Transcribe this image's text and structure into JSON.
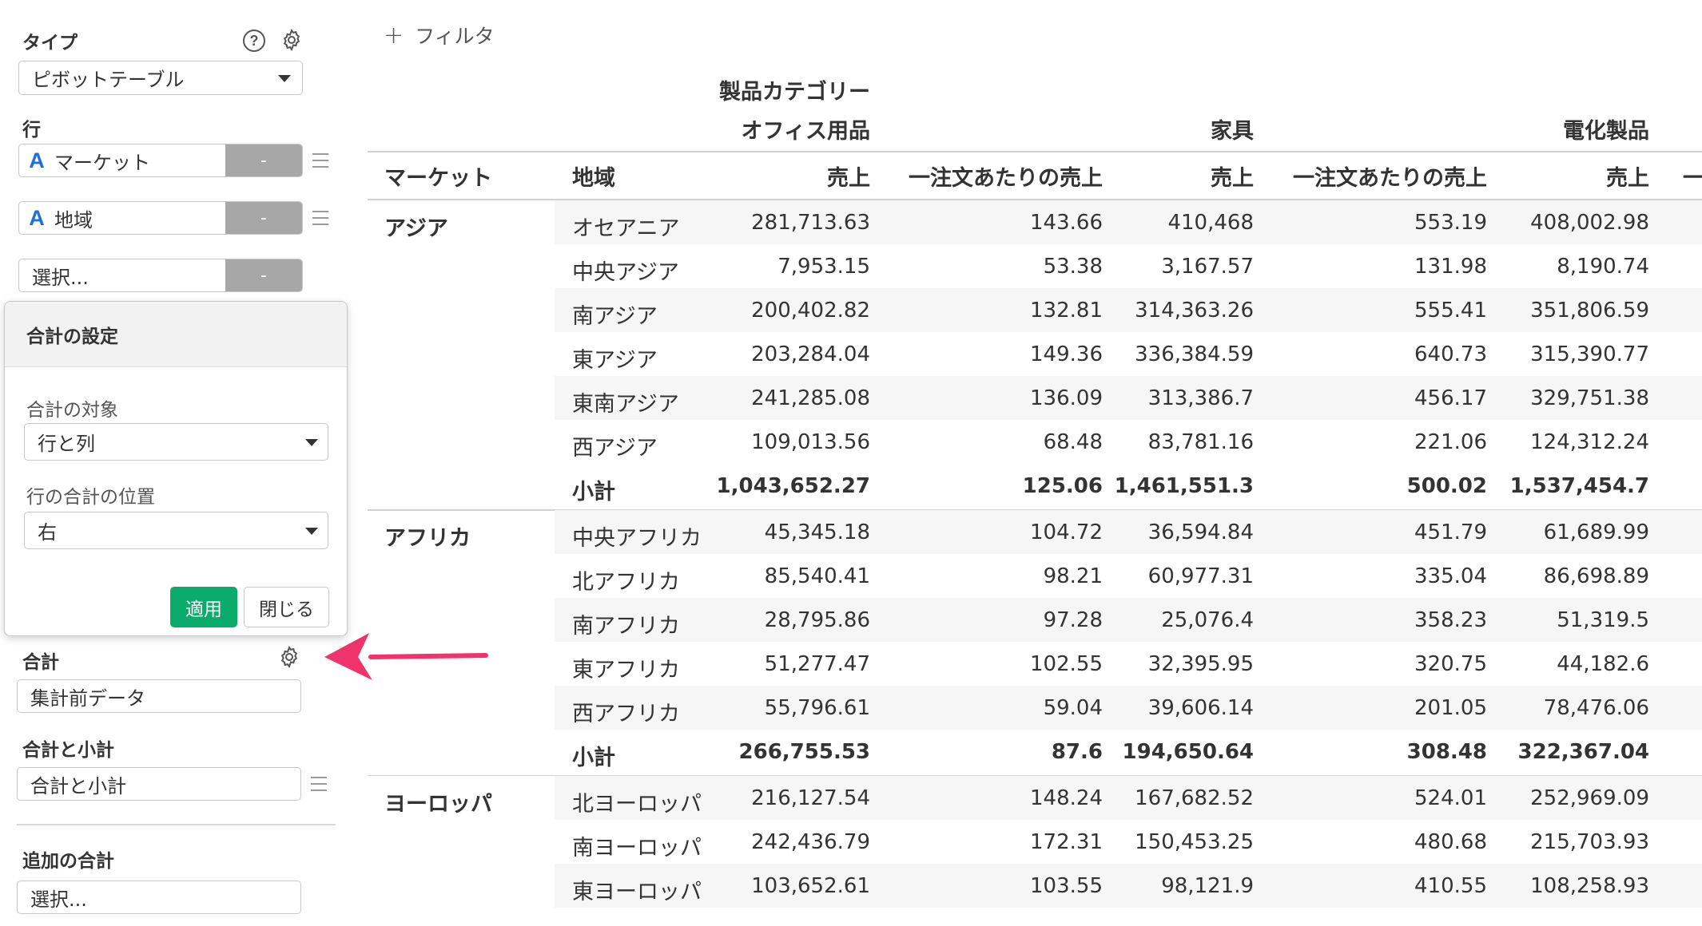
{
  "panel": {
    "type_label": "タイプ",
    "type_value": "ピボットテーブル",
    "row_label": "行",
    "row_fields": [
      "マーケット",
      "地域"
    ],
    "row_select_placeholder": "選択...",
    "minus_label": "-",
    "total_label": "合計",
    "total_value": "集計前データ",
    "total_subtotal_label": "合計と小計",
    "total_subtotal_value": "合計と小計",
    "additional_total_label": "追加の合計",
    "additional_total_placeholder": "選択..."
  },
  "popover": {
    "title": "合計の設定",
    "target_label": "合計の対象",
    "target_value": "行と列",
    "position_label": "行の合計の位置",
    "position_value": "右",
    "apply_label": "適用",
    "close_label": "閉じる"
  },
  "filter": {
    "label": "フィルタ"
  },
  "pivot": {
    "column_dimension": "製品カテゴリー",
    "categories": [
      "オフィス用品",
      "家具",
      "電化製品"
    ],
    "row_headers": {
      "market": "マーケット",
      "region": "地域"
    },
    "measures": [
      "売上",
      "一注文あたりの売上",
      "売上",
      "一注文あたりの売上",
      "売上"
    ],
    "trailing_header": "一",
    "groups": [
      {
        "market": "アジア",
        "rows": [
          {
            "region": "オセアニア",
            "values": [
              "281,713.63",
              "143.66",
              "410,468",
              "553.19",
              "408,002.98"
            ]
          },
          {
            "region": "中央アジア",
            "values": [
              "7,953.15",
              "53.38",
              "3,167.57",
              "131.98",
              "8,190.74"
            ]
          },
          {
            "region": "南アジア",
            "values": [
              "200,402.82",
              "132.81",
              "314,363.26",
              "555.41",
              "351,806.59"
            ]
          },
          {
            "region": "東アジア",
            "values": [
              "203,284.04",
              "149.36",
              "336,384.59",
              "640.73",
              "315,390.77"
            ]
          },
          {
            "region": "東南アジア",
            "values": [
              "241,285.08",
              "136.09",
              "313,386.7",
              "456.17",
              "329,751.38"
            ]
          },
          {
            "region": "西アジア",
            "values": [
              "109,013.56",
              "68.48",
              "83,781.16",
              "221.06",
              "124,312.24"
            ]
          }
        ],
        "subtotal": {
          "label": "小計",
          "values": [
            "1,043,652.27",
            "125.06",
            "1,461,551.3",
            "500.02",
            "1,537,454.7"
          ]
        }
      },
      {
        "market": "アフリカ",
        "rows": [
          {
            "region": "中央アフリカ",
            "values": [
              "45,345.18",
              "104.72",
              "36,594.84",
              "451.79",
              "61,689.99"
            ]
          },
          {
            "region": "北アフリカ",
            "values": [
              "85,540.41",
              "98.21",
              "60,977.31",
              "335.04",
              "86,698.89"
            ]
          },
          {
            "region": "南アフリカ",
            "values": [
              "28,795.86",
              "97.28",
              "25,076.4",
              "358.23",
              "51,319.5"
            ]
          },
          {
            "region": "東アフリカ",
            "values": [
              "51,277.47",
              "102.55",
              "32,395.95",
              "320.75",
              "44,182.6"
            ]
          },
          {
            "region": "西アフリカ",
            "values": [
              "55,796.61",
              "59.04",
              "39,606.14",
              "201.05",
              "78,476.06"
            ]
          }
        ],
        "subtotal": {
          "label": "小計",
          "values": [
            "266,755.53",
            "87.6",
            "194,650.64",
            "308.48",
            "322,367.04"
          ]
        }
      },
      {
        "market": "ヨーロッパ",
        "rows": [
          {
            "region": "北ヨーロッパ",
            "values": [
              "216,127.54",
              "148.24",
              "167,682.52",
              "524.01",
              "252,969.09"
            ]
          },
          {
            "region": "南ヨーロッパ",
            "values": [
              "242,436.79",
              "172.31",
              "150,453.25",
              "480.68",
              "215,703.93"
            ]
          },
          {
            "region": "東ヨーロッパ",
            "values": [
              "103,652.61",
              "103.55",
              "98,121.9",
              "410.55",
              "108,258.93"
            ]
          }
        ]
      }
    ]
  },
  "colors": {
    "accent_green": "#0aab6b",
    "arrow_pink": "#f0336b",
    "field_icon_blue": "#1e6fd6"
  }
}
